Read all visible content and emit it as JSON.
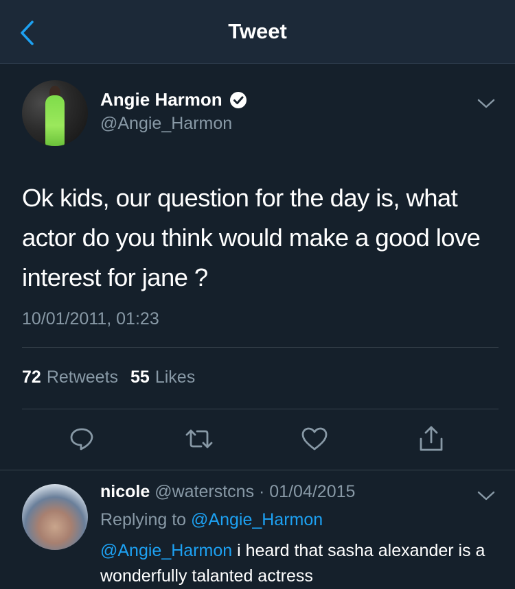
{
  "nav": {
    "title": "Tweet"
  },
  "tweet": {
    "author_name": "Angie Harmon",
    "author_handle": "@Angie_Harmon",
    "text": "Ok kids, our question for the day is, what actor do you think would make a good love interest for jane ?",
    "timestamp": "10/01/2011, 01:23",
    "retweets_count": "72",
    "retweets_label": "Retweets",
    "likes_count": "55",
    "likes_label": "Likes"
  },
  "actions": {
    "icons": [
      "reply-icon",
      "retweet-icon",
      "like-icon",
      "share-icon"
    ]
  },
  "reply": {
    "name": "nicole",
    "meta": "@waterstcns · 01/04/2015",
    "replying_prefix": "Replying to",
    "replying_handle": "@Angie_Harmon",
    "mention": "@Angie_Harmon",
    "text": "i heard that sasha alexander is a wonderfully talanted actress"
  },
  "colors": {
    "background": "#15202b",
    "navbar": "#1c2938",
    "accent": "#1da1f2",
    "secondary_text": "#8899a6",
    "divider": "#38444d"
  }
}
